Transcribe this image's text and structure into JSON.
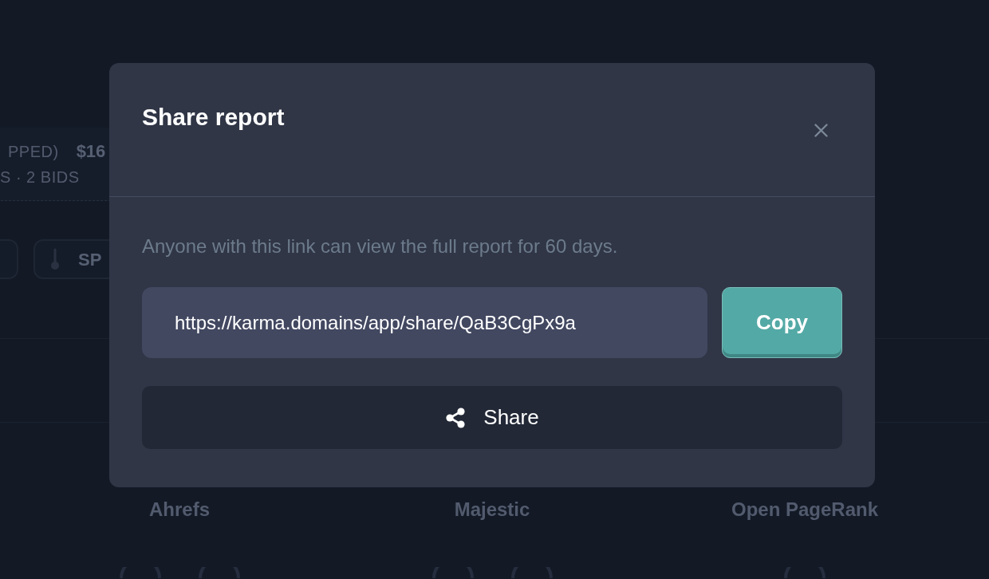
{
  "background": {
    "card": {
      "line_1": "PPED)",
      "price": "$16",
      "line_2": "S · 2 BIDS"
    },
    "buttons": [
      {
        "kind": "plain"
      },
      {
        "label": "SP",
        "kind": "with_icon"
      }
    ],
    "metrics": [
      "Ahrefs",
      "Majestic",
      "Open PageRank"
    ]
  },
  "dialog": {
    "title": "Share report",
    "description": "Anyone with this link can view the full report for 60 days.",
    "link_field": {
      "value": "https://karma.domains/app/share/QaB3CgPx9a"
    },
    "copy_button": "Copy",
    "share_button": "Share"
  }
}
